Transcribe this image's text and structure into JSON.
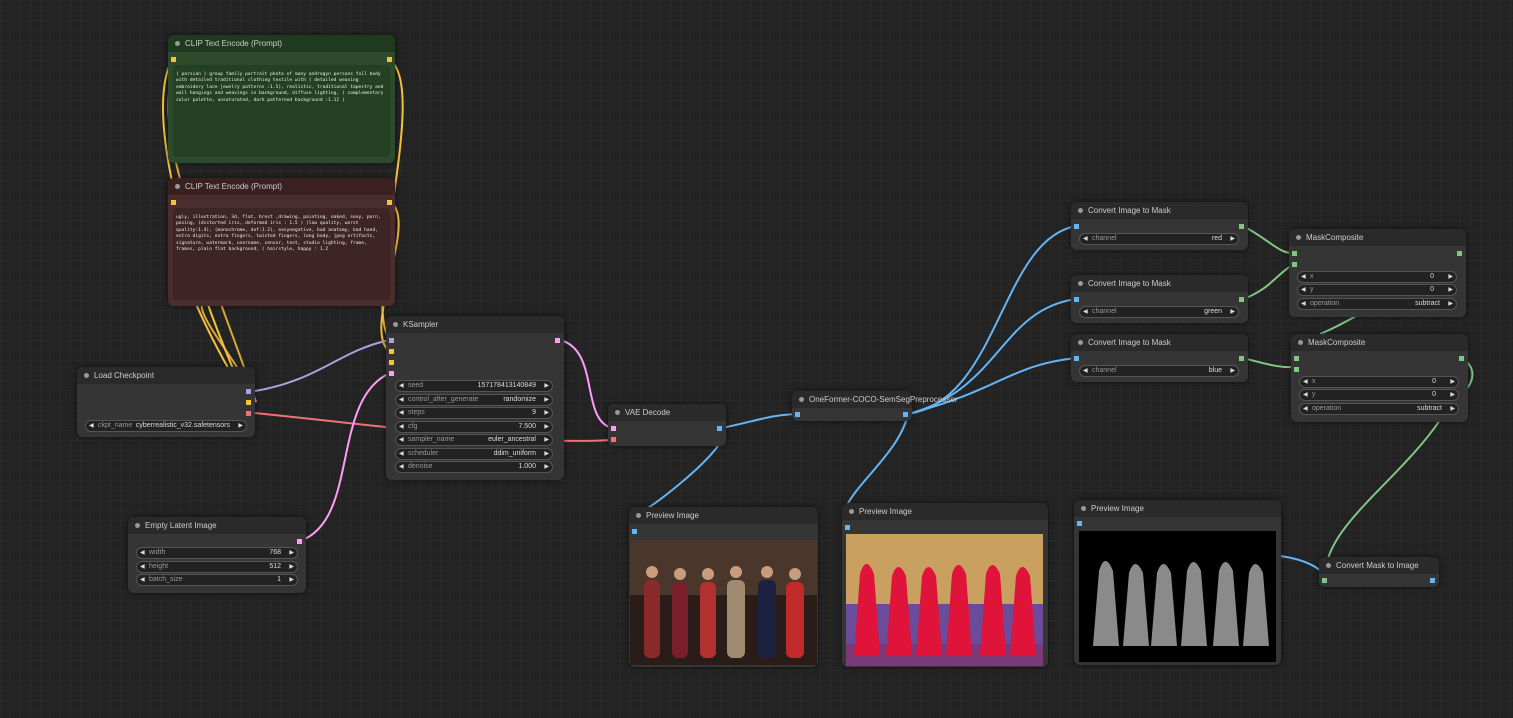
{
  "nodes": {
    "clip_pos": {
      "title": "CLIP Text Encode (Prompt)",
      "text": "( parsian ) group family portrait photo of many androgyn persons full body with detailed traditional clothing textile with ( detailed weaving embroidery lace jewelry patterns :1.5), realistic, traditional tapestry and wall hangings and weavings in background, diffuse lighting, ( complementary color palette, unsaturated, dark patterned background :1.12 )"
    },
    "clip_neg": {
      "title": "CLIP Text Encode (Prompt)",
      "text": "ugly, illustration, 3d, flat, brest ,drawing, painting, naked, sexy, porn, posing, (distorted iris, deformed iris : 1.5 ) (low quality, worst quality:1.4), (monochrome, dof:1.2), easynegative, bad anatomy, bad hand, extra digits, extra fingers, twisted fingers, long body, jpeg artifacts, signature, watermark, username, censor, text, studio lighting, frame, frames, plain flat background, ( hairstyle, happy : 1.2"
    },
    "load_checkpoint": {
      "title": "Load Checkpoint",
      "ckpt_label": "ckpt_name",
      "ckpt_value": "cyberrealistic_v32.safetensors"
    },
    "empty_latent": {
      "title": "Empty Latent Image",
      "widgets": [
        {
          "label": "width",
          "value": "768"
        },
        {
          "label": "height",
          "value": "512"
        },
        {
          "label": "batch_size",
          "value": "1"
        }
      ]
    },
    "ksampler": {
      "title": "KSampler",
      "widgets": [
        {
          "label": "seed",
          "value": "157178413140849"
        },
        {
          "label": "control_after_generate",
          "value": "randomize"
        },
        {
          "label": "steps",
          "value": "9"
        },
        {
          "label": "cfg",
          "value": "7.500"
        },
        {
          "label": "sampler_name",
          "value": "euler_ancestral"
        },
        {
          "label": "scheduler",
          "value": "ddim_uniform"
        },
        {
          "label": "denoise",
          "value": "1.000"
        }
      ]
    },
    "vae_decode": {
      "title": "VAE Decode"
    },
    "oneformer": {
      "title": "OneFormer-COCO-SemSegPreprocessor"
    },
    "preview1": {
      "title": "Preview Image"
    },
    "preview2": {
      "title": "Preview Image"
    },
    "preview3": {
      "title": "Preview Image"
    },
    "conv_red": {
      "title": "Convert Image to Mask",
      "label": "channel",
      "value": "red"
    },
    "conv_green": {
      "title": "Convert Image to Mask",
      "label": "channel",
      "value": "green"
    },
    "conv_blue": {
      "title": "Convert Image to Mask",
      "label": "channel",
      "value": "blue"
    },
    "mask_comp1": {
      "title": "MaskComposite",
      "widgets": [
        {
          "label": "x",
          "value": "0"
        },
        {
          "label": "y",
          "value": "0"
        },
        {
          "label": "operation",
          "value": "subtract"
        }
      ]
    },
    "mask_comp2": {
      "title": "MaskComposite",
      "widgets": [
        {
          "label": "x",
          "value": "0"
        },
        {
          "label": "y",
          "value": "0"
        },
        {
          "label": "operation",
          "value": "subtract"
        }
      ]
    },
    "mask_to_image": {
      "title": "Convert Mask to Image"
    }
  },
  "colors": {
    "clip_link": "#f7c13a",
    "model_link": "#b39ddb",
    "vae_link": "#f07178",
    "latent_link": "#ff9cf9",
    "image_link": "#64b5f6",
    "mask_link": "#81c784",
    "clip_pos_bg": "#2d4a2d",
    "clip_neg_bg": "#4a2d2d"
  }
}
